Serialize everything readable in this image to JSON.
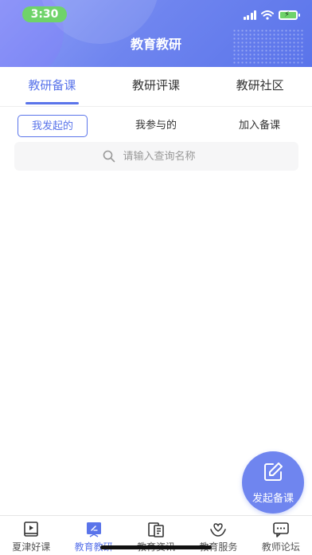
{
  "status_bar": {
    "time": "3:30"
  },
  "header": {
    "title": "教育教研"
  },
  "tabs": [
    {
      "label": "教研备课",
      "active": true
    },
    {
      "label": "教研评课",
      "active": false
    },
    {
      "label": "教研社区",
      "active": false
    }
  ],
  "subtabs": [
    {
      "label": "我发起的",
      "active": true
    },
    {
      "label": "我参与的",
      "active": false
    },
    {
      "label": "加入备课",
      "active": false
    }
  ],
  "search": {
    "placeholder": "请输入查询名称",
    "icon": "search-icon"
  },
  "fab": {
    "label": "发起备课",
    "icon": "edit-icon"
  },
  "bottom_nav": [
    {
      "label": "夏津好课",
      "icon": "video-book-icon",
      "active": false
    },
    {
      "label": "教育教研",
      "icon": "pen-board-icon",
      "active": true
    },
    {
      "label": "教育资讯",
      "icon": "news-icon",
      "active": false
    },
    {
      "label": "教育服务",
      "icon": "heart-hands-icon",
      "active": false
    },
    {
      "label": "教师论坛",
      "icon": "chat-icon",
      "active": false
    }
  ],
  "colors": {
    "accent": "#5a74ea",
    "header_start": "#8f9ff7",
    "header_end": "#5a74ea",
    "time_pill": "#6fd36a"
  }
}
